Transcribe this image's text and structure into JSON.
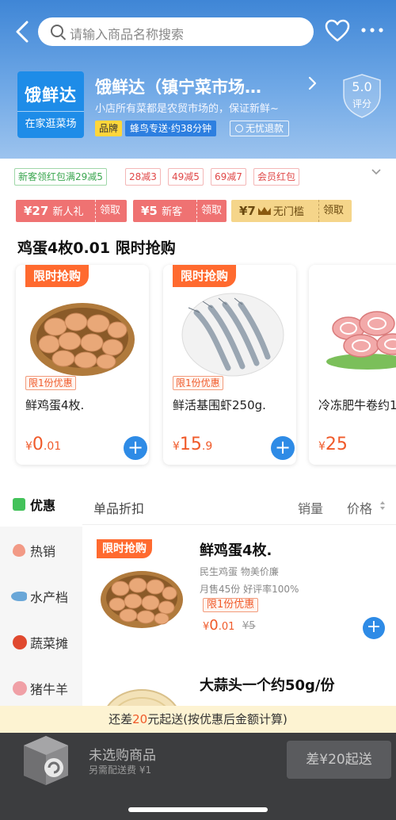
{
  "header": {
    "search_placeholder": "请输入商品名称搜索",
    "store": {
      "logo_line1": "饿鲜达",
      "logo_line2": "在家逛菜场",
      "name": "饿鲜达（镇宁菜市场…",
      "description": "小店所有菜都是农贸市场的，保证新鲜~",
      "tag_brand": "品牌",
      "tag_delivery": "蜂鸟专送·约38分钟",
      "tag_return": "无忧退款",
      "rating_value": "5.0",
      "rating_label": "评分"
    }
  },
  "promos": [
    "新客领红包满29减5",
    "28减3",
    "49减5",
    "69减7",
    "会员红包"
  ],
  "coupons": [
    {
      "value": "¥27",
      "desc": "新人礼",
      "action": "领取"
    },
    {
      "value": "¥5",
      "desc": "新客",
      "action": "领取"
    },
    {
      "value": "¥7",
      "desc": "无门槛",
      "action": "领取"
    }
  ],
  "flash": {
    "title": "鸡蛋4枚0.01 限时抢购",
    "badge": "限时抢购",
    "cards": [
      {
        "limit": "限1份优惠",
        "name": "鲜鸡蛋4枚.",
        "currency": "¥",
        "price_int": "0",
        "price_dec": ".01"
      },
      {
        "limit": "限1份优惠",
        "name": "鲜活基围虾250g.",
        "currency": "¥",
        "price_int": "15",
        "price_dec": ".9"
      },
      {
        "name": "冷冻肥牛卷约1",
        "currency": "¥",
        "price_int": "25"
      }
    ]
  },
  "nav": [
    {
      "label": "优惠",
      "icon": "discount-icon"
    },
    {
      "label": "热销",
      "icon": "hot-icon"
    },
    {
      "label": "水产档",
      "icon": "fish-icon"
    },
    {
      "label": "蔬菜摊",
      "icon": "tomato-icon"
    },
    {
      "label": "猪牛羊",
      "icon": "pig-icon"
    }
  ],
  "list": {
    "section_title": "单品折扣",
    "sort_sales": "销量",
    "sort_price": "价格",
    "products": [
      {
        "badge": "限时抢购",
        "name": "鲜鸡蛋4枚.",
        "subtitle": "民生鸡蛋 物美价廉",
        "meta": "月售45份 好评率100%",
        "limit": "限1份优惠",
        "currency": "¥",
        "price_int": "0",
        "price_dec": ".01",
        "original_price": "¥5"
      },
      {
        "name": "大蒜头一个约50g/份"
      }
    ]
  },
  "cart": {
    "threshold_prefix": "还差",
    "threshold_amount": "20",
    "threshold_suffix": "元起送(按优惠后金额计算)",
    "title": "未选购商品",
    "subtitle": "另需配送费 ¥1",
    "button": "差¥20起送"
  },
  "colors": {
    "brand_blue": "#2e8be6",
    "price_orange": "#f05a2a",
    "flash_badge": "#ff6a2f"
  }
}
